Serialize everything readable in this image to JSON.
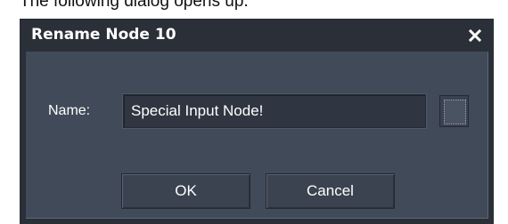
{
  "background_caption": "The following dialog opens up.",
  "dialog": {
    "title": "Rename Node 10",
    "close_glyph": "×",
    "name_label": "Name:",
    "name_value": "Special Input Node!",
    "ok_label": "OK",
    "cancel_label": "Cancel"
  },
  "colors": {
    "title_bar": "#2a2f38",
    "client_bg": "#414a58",
    "input_bg": "#2f3642",
    "button_bg": "#3b4350",
    "text": "#ffffff"
  },
  "icons": {
    "close": "close-icon",
    "color_swatch": "color-swatch-icon"
  }
}
